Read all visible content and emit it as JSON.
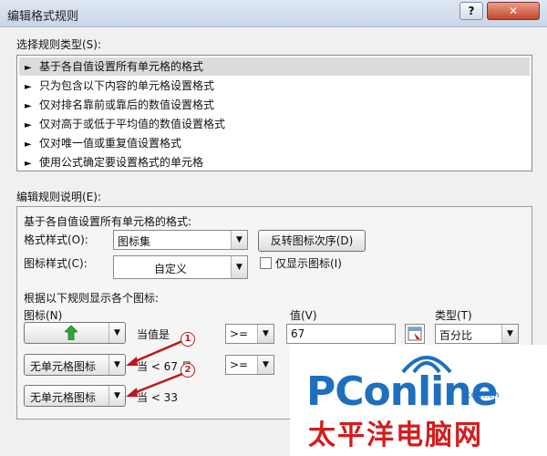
{
  "window": {
    "title": "编辑格式规则",
    "help_glyph": "?",
    "close_glyph": "✕"
  },
  "rule_type": {
    "label": "选择规则类型(S):",
    "items": [
      "基于各自值设置所有单元格的格式",
      "只为包含以下内容的单元格设置格式",
      "仅对排名靠前或靠后的数值设置格式",
      "仅对高于或低于平均值的数值设置格式",
      "仅对唯一值或重复值设置格式",
      "使用公式确定要设置格式的单元格"
    ],
    "selected_index": 0,
    "bullet": "►"
  },
  "description": {
    "label": "编辑规则说明(E):",
    "heading": "基于各自值设置所有单元格的格式:",
    "format_style_label": "格式样式(O):",
    "format_style_value": "图标集",
    "reverse_button": "反转图标次序(D)",
    "icon_style_label": "图标样式(C):",
    "icon_style_value": "自定义",
    "show_icon_only_label": "仅显示图标(I)",
    "rules_heading": "根据以下规则显示各个图标:",
    "col_icon": "图标(N)",
    "col_value": "值(V)",
    "col_type": "类型(T)",
    "row1": {
      "condition_text": "当值是",
      "operator": ">=",
      "value": "67",
      "type": "百分比"
    },
    "row2": {
      "icon": "无单元格图标",
      "condition_text": "当 < 67 且",
      "operator": ">="
    },
    "row3": {
      "icon": "无单元格图标",
      "condition_text": "当 < 33"
    },
    "markers": [
      "1",
      "2"
    ]
  },
  "watermark": {
    "brand": "PConline",
    "domain": ".com.cn",
    "chinese": "太平洋电脑网"
  },
  "colors": {
    "green_arrow": "#2fa832",
    "marker_red": "#c0151b",
    "brand_blue": "#1f6fbf"
  }
}
